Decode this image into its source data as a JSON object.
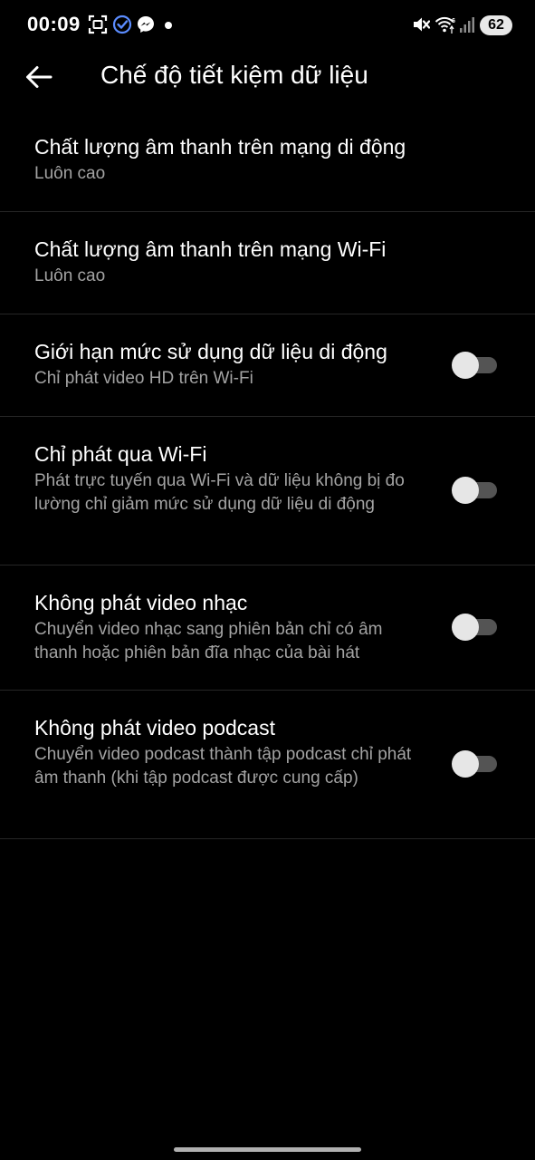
{
  "status_bar": {
    "time": "00:09",
    "battery": "62",
    "icons": [
      "screenshot-icon",
      "check-badge-icon",
      "messenger-icon",
      "notification-dot-icon",
      "mute-icon",
      "wifi-icon",
      "signal-icon",
      "battery-icon"
    ]
  },
  "header": {
    "title": "Chế độ tiết kiệm dữ liệu",
    "back_icon": "arrow-left-icon"
  },
  "settings": [
    {
      "title": "Chất lượng âm thanh trên mạng di động",
      "subtitle": "Luôn cao"
    },
    {
      "title": "Chất lượng âm thanh trên mạng Wi-Fi",
      "subtitle": "Luôn cao"
    },
    {
      "title": "Giới hạn mức sử dụng dữ liệu di động",
      "subtitle": "Chỉ phát video HD trên Wi-Fi",
      "toggle_on": false
    },
    {
      "title": "Chỉ phát qua Wi-Fi",
      "subtitle": "Phát trực tuyến qua Wi-Fi và dữ liệu không bị đo lường chỉ giảm mức sử dụng dữ liệu di động",
      "toggle_on": false
    },
    {
      "title": "Không phát video nhạc",
      "subtitle": "Chuyển video nhạc sang phiên bản chỉ có âm thanh hoặc phiên bản đĩa nhạc của bài hát",
      "toggle_on": false
    },
    {
      "title": "Không phát video podcast",
      "subtitle": "Chuyển video podcast thành tập podcast chỉ phát âm thanh (khi tập podcast được cung cấp)",
      "toggle_on": false
    }
  ],
  "colors": {
    "background": "#000000",
    "text_primary": "#ffffff",
    "text_secondary": "#a3a3a3",
    "toggle_track_off": "#545454",
    "toggle_knob_off": "#e6e6e6",
    "divider": "#262626"
  }
}
